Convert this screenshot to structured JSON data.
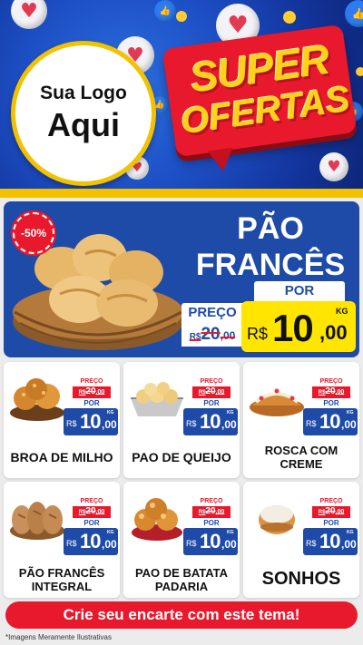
{
  "header": {
    "logo_line1": "Sua Logo",
    "logo_line2": "Aqui",
    "super_word1": "SUPER",
    "super_word2": "OFERTAS",
    "heart_icon": "♥",
    "like_icon": "👍"
  },
  "featured": {
    "discount": "-50%",
    "name_line1": "PÃO",
    "name_line2": "FRANCÊS",
    "preco_label": "PREÇO",
    "old_currency": "R$",
    "old_value": "20",
    "old_cents": ",00",
    "por_label": "POR",
    "new_currency": "R$",
    "new_value": "10",
    "new_cents": ",00",
    "unit": "KG"
  },
  "products": [
    {
      "name_line1": "BROA DE MILHO",
      "name_line2": "",
      "preco_label": "PREÇO",
      "old_currency": "R$",
      "old_value": "20",
      "old_cents": ",00",
      "por_label": "POR",
      "new_currency": "R$",
      "new_value": "10",
      "new_cents": ",00",
      "unit": "KG",
      "icon": "cornbread-icon"
    },
    {
      "name_line1": "PAO DE QUEIJO",
      "name_line2": "",
      "preco_label": "PREÇO",
      "old_currency": "R$",
      "old_value": "20",
      "old_cents": ",00",
      "por_label": "POR",
      "new_currency": "R$",
      "new_value": "10",
      "new_cents": ",00",
      "unit": "KG",
      "icon": "cheese-bread-icon"
    },
    {
      "name_line1": "ROSCA COM",
      "name_line2": "CREME",
      "preco_label": "PREÇO",
      "old_currency": "R$",
      "old_value": "20",
      "old_cents": ",00",
      "por_label": "POR",
      "new_currency": "R$",
      "new_value": "10",
      "new_cents": ",00",
      "unit": "KG",
      "icon": "cream-roll-icon"
    },
    {
      "name_line1": "PÃO FRANCÊS",
      "name_line2": "INTEGRAL",
      "preco_label": "PREÇO",
      "old_currency": "R$",
      "old_value": "20",
      "old_cents": ",00",
      "por_label": "POR",
      "new_currency": "R$",
      "new_value": "10",
      "new_cents": ",00",
      "unit": "KG",
      "icon": "wholegrain-bread-icon"
    },
    {
      "name_line1": "PAO DE BATATA",
      "name_line2": "PADARIA",
      "preco_label": "PREÇO",
      "old_currency": "R$",
      "old_value": "20",
      "old_cents": ",00",
      "por_label": "POR",
      "new_currency": "R$",
      "new_value": "10",
      "new_cents": ",00",
      "unit": "KG",
      "icon": "potato-bread-icon"
    },
    {
      "name_line1": "SONHOS",
      "name_line2": "",
      "preco_label": "PREÇO",
      "old_currency": "R$",
      "old_value": "20",
      "old_cents": ",00",
      "por_label": "POR",
      "new_currency": "R$",
      "new_value": "10",
      "new_cents": ",00",
      "unit": "KG",
      "icon": "sonho-donut-icon"
    }
  ],
  "cta": "Crie seu encarte com este tema!",
  "disclaimer": "*Imagens Meramente Ilustrativas",
  "colors": {
    "brand_blue": "#1e4aa8",
    "brand_red": "#e8192c",
    "brand_yellow": "#ffe500",
    "accent_gold": "#f2c200"
  }
}
